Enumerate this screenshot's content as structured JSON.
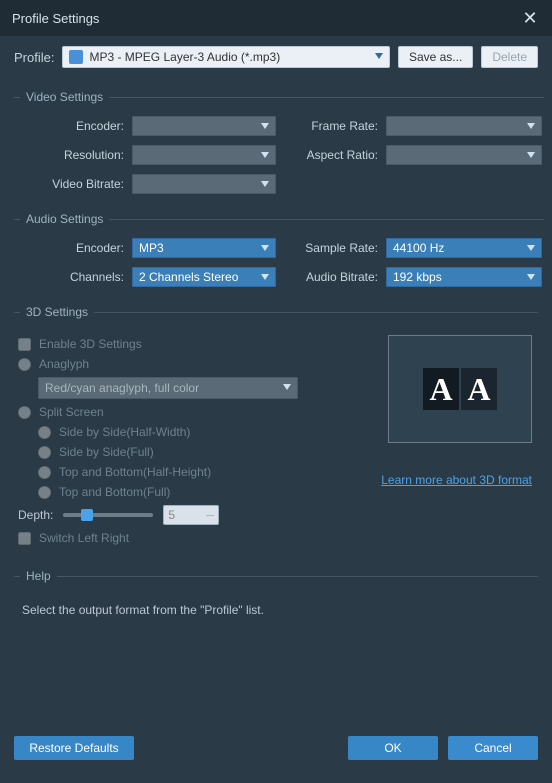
{
  "title": "Profile Settings",
  "profile": {
    "label": "Profile:",
    "value": "MP3 - MPEG Layer-3 Audio (*.mp3)",
    "save_label": "Save as...",
    "delete_label": "Delete"
  },
  "video_settings": {
    "legend": "Video Settings",
    "encoder_label": "Encoder:",
    "resolution_label": "Resolution:",
    "bitrate_label": "Video Bitrate:",
    "framerate_label": "Frame Rate:",
    "aspect_label": "Aspect Ratio:",
    "encoder": "",
    "resolution": "",
    "bitrate": "",
    "framerate": "",
    "aspect": ""
  },
  "audio_settings": {
    "legend": "Audio Settings",
    "encoder_label": "Encoder:",
    "channels_label": "Channels:",
    "samplerate_label": "Sample Rate:",
    "bitrate_label": "Audio Bitrate:",
    "encoder": "MP3",
    "channels": "2 Channels Stereo",
    "samplerate": "44100 Hz",
    "bitrate": "192 kbps"
  },
  "three_d": {
    "legend": "3D Settings",
    "enable": "Enable 3D Settings",
    "anaglyph": "Anaglyph",
    "anaglyph_mode": "Red/cyan anaglyph, full color",
    "split": "Split Screen",
    "sbs_half": "Side by Side(Half-Width)",
    "sbs_full": "Side by Side(Full)",
    "tab_half": "Top and Bottom(Half-Height)",
    "tab_full": "Top and Bottom(Full)",
    "depth_label": "Depth:",
    "depth_value": "5",
    "switch_lr": "Switch Left Right",
    "learn": "Learn more about 3D format"
  },
  "help": {
    "legend": "Help",
    "text": "Select the output format from the \"Profile\" list."
  },
  "footer": {
    "restore": "Restore Defaults",
    "ok": "OK",
    "cancel": "Cancel"
  }
}
